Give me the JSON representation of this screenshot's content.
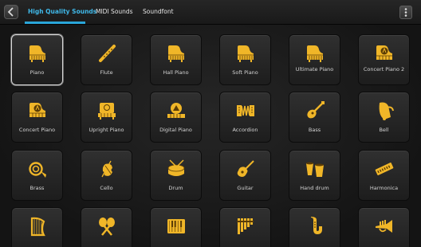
{
  "tabs": [
    {
      "label": "High Quality Sounds",
      "active": true
    },
    {
      "label": "MIDI Sounds",
      "active": false
    },
    {
      "label": "Soundfont",
      "active": false
    }
  ],
  "icon_color": "#f0b628",
  "accent_color": "#3fb8e8",
  "instruments": [
    {
      "label": "Piano",
      "icon": "grand-piano-icon",
      "selected": true
    },
    {
      "label": "Flute",
      "icon": "flute-icon"
    },
    {
      "label": "Hall Piano",
      "icon": "grand-piano-icon"
    },
    {
      "label": "Soft Piano",
      "icon": "grand-piano-icon"
    },
    {
      "label": "Ultimate Piano",
      "icon": "grand-piano-icon"
    },
    {
      "label": "Concert Piano 2",
      "icon": "concert-piano-icon"
    },
    {
      "label": "Concert Piano",
      "icon": "concert-piano-icon"
    },
    {
      "label": "Upright Piano",
      "icon": "upright-piano-icon"
    },
    {
      "label": "Digital Piano",
      "icon": "digital-piano-icon"
    },
    {
      "label": "Accordion",
      "icon": "accordion-icon"
    },
    {
      "label": "Bass",
      "icon": "bass-guitar-icon"
    },
    {
      "label": "Bell",
      "icon": "bell-icon"
    },
    {
      "label": "Brass",
      "icon": "french-horn-icon"
    },
    {
      "label": "Cello",
      "icon": "cello-icon"
    },
    {
      "label": "Drum",
      "icon": "drum-icon"
    },
    {
      "label": "Guitar",
      "icon": "guitar-icon"
    },
    {
      "label": "Hand drum",
      "icon": "bongo-icon"
    },
    {
      "label": "Harmonica",
      "icon": "harmonica-icon"
    },
    {
      "label": "",
      "icon": "harp-icon"
    },
    {
      "label": "",
      "icon": "maracas-icon"
    },
    {
      "label": "",
      "icon": "keyboard-icon"
    },
    {
      "label": "",
      "icon": "pan-flute-icon"
    },
    {
      "label": "",
      "icon": "saxophone-icon"
    },
    {
      "label": "",
      "icon": "trumpet-icon"
    }
  ]
}
